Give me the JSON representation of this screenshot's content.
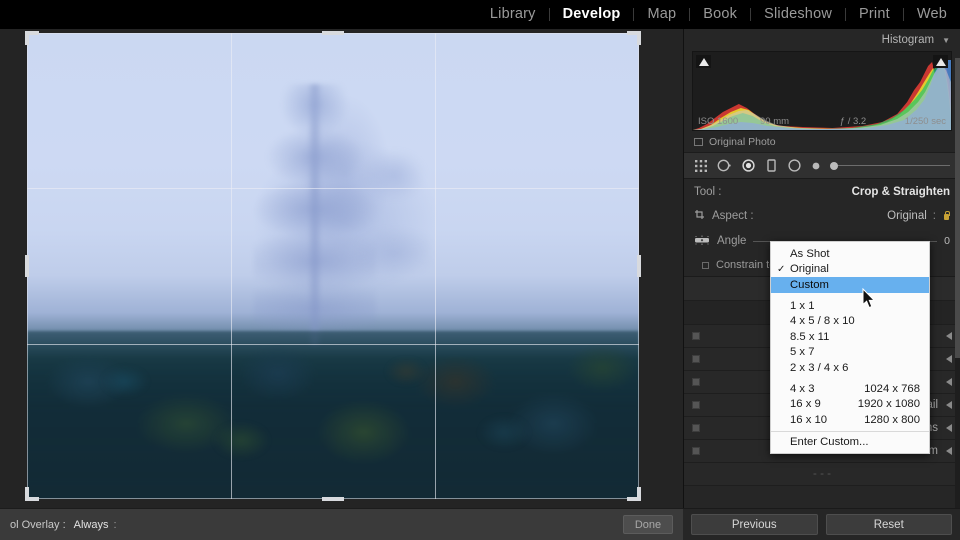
{
  "topbar": {
    "modules": [
      {
        "label": "Library",
        "active": false
      },
      {
        "label": "Develop",
        "active": true
      },
      {
        "label": "Map",
        "active": false
      },
      {
        "label": "Book",
        "active": false
      },
      {
        "label": "Slideshow",
        "active": false
      },
      {
        "label": "Print",
        "active": false
      },
      {
        "label": "Web",
        "active": false
      }
    ]
  },
  "histogram": {
    "title": "Histogram",
    "collapse_glyph": "▼",
    "exif": {
      "iso": "ISO 1600",
      "focal": "90 mm",
      "aperture": "ƒ / 3.2",
      "shutter": "1/250 sec"
    },
    "original_photo": "Original Photo"
  },
  "tool": {
    "label": "Tool :",
    "value": "Crop & Straighten",
    "aspect_label": "Aspect :",
    "aspect_value": "Original",
    "aspect_colon": ":",
    "angle_label": "Angle",
    "angle_value": "0",
    "constrain_label": "Constrain to Image"
  },
  "aspect_menu": {
    "items": [
      {
        "label": "As Shot",
        "checked": false,
        "selected": false,
        "dim": ""
      },
      {
        "label": "Original",
        "checked": true,
        "selected": false,
        "dim": ""
      },
      {
        "label": "Custom",
        "checked": false,
        "selected": true,
        "dim": ""
      },
      {
        "gap": true
      },
      {
        "label": "1 x 1",
        "checked": false,
        "selected": false,
        "dim": ""
      },
      {
        "label": "4 x 5  /  8 x 10",
        "checked": false,
        "selected": false,
        "dim": ""
      },
      {
        "label": "8.5 x 11",
        "checked": false,
        "selected": false,
        "dim": ""
      },
      {
        "label": "5 x 7",
        "checked": false,
        "selected": false,
        "dim": ""
      },
      {
        "label": "2 x 3  /  4 x 6",
        "checked": false,
        "selected": false,
        "dim": ""
      },
      {
        "gap": true
      },
      {
        "label": "4 x 3",
        "checked": false,
        "selected": false,
        "dim": "1024 x 768"
      },
      {
        "label": "16 x 9",
        "checked": false,
        "selected": false,
        "dim": "1920 x 1080"
      },
      {
        "label": "16 x 10",
        "checked": false,
        "selected": false,
        "dim": "1280 x 800"
      },
      {
        "sep": true
      },
      {
        "label": "Enter Custom...",
        "checked": false,
        "selected": false,
        "dim": ""
      }
    ]
  },
  "panels": [
    {
      "label": "Detail"
    },
    {
      "label": "Lens Corrections"
    },
    {
      "label": "Transform"
    }
  ],
  "toolbar": {
    "overlay_label": "ol Overlay :",
    "overlay_value": "Always",
    "overlay_colon": ":",
    "done": "Done"
  },
  "footer": {
    "previous": "Previous",
    "reset": "Reset"
  },
  "colors": {
    "accent_selected": "#67b0ee",
    "panel_bg": "#262626",
    "stage_bg": "#242424",
    "lock_gold": "#c8a235"
  }
}
